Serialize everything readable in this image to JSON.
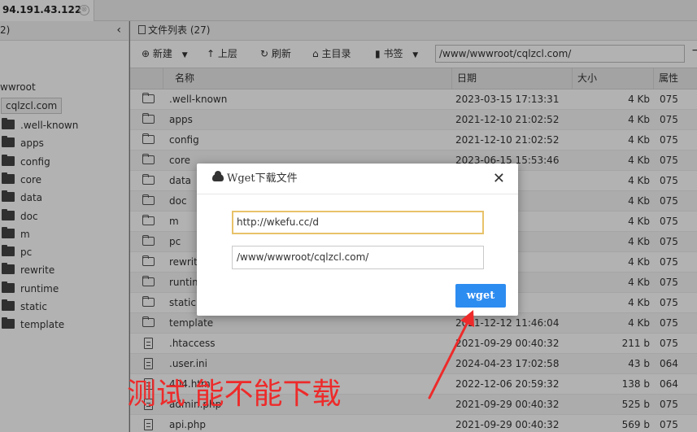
{
  "tab": {
    "title": "94.191.43.122",
    "close_symbol": "⊗"
  },
  "tree": {
    "header": "2)",
    "collapse_symbol": "‹",
    "root_label": "wwroot",
    "selected_label": "cqlzcl.com",
    "items": [
      ".well-known",
      "apps",
      "config",
      "core",
      "data",
      "doc",
      "m",
      "pc",
      "rewrite",
      "runtime",
      "static",
      "template"
    ]
  },
  "files": {
    "header_title": "文件列表 (27)",
    "toolbar": {
      "new_label": "新建",
      "up_label": "上层",
      "refresh_label": "刷新",
      "home_label": "主目录",
      "bookmark_label": "书签",
      "path_value": "/www/wwwroot/cqlzcl.com/"
    },
    "columns": {
      "name": "名称",
      "date": "日期",
      "size": "大小",
      "perm": "属性"
    },
    "rows": [
      {
        "icon": "folder-icon",
        "name": ".well-known",
        "date": "2023-03-15 17:13:31",
        "size": "4 Kb",
        "perm": "075"
      },
      {
        "icon": "folder-icon",
        "name": "apps",
        "date": "2021-12-10 21:02:52",
        "size": "4 Kb",
        "perm": "075"
      },
      {
        "icon": "folder-icon",
        "name": "config",
        "date": "2021-12-10 21:02:52",
        "size": "4 Kb",
        "perm": "075"
      },
      {
        "icon": "folder-icon",
        "name": "core",
        "date": "2023-06-15 15:53:46",
        "size": "4 Kb",
        "perm": "075"
      },
      {
        "icon": "folder-icon",
        "name": "data",
        "date": "7:08:44",
        "size": "4 Kb",
        "perm": "075"
      },
      {
        "icon": "folder-icon",
        "name": "doc",
        "date": "1:02:54",
        "size": "4 Kb",
        "perm": "075"
      },
      {
        "icon": "folder-icon",
        "name": "m",
        "date": "1:02:54",
        "size": "4 Kb",
        "perm": "075"
      },
      {
        "icon": "folder-icon",
        "name": "pc",
        "date": "1:02:54",
        "size": "4 Kb",
        "perm": "075"
      },
      {
        "icon": "folder-icon",
        "name": "rewrit",
        "date": "1:02:54",
        "size": "4 Kb",
        "perm": "075"
      },
      {
        "icon": "folder-icon",
        "name": "runtim",
        "date": "9:03:40",
        "size": "4 Kb",
        "perm": "075"
      },
      {
        "icon": "folder-icon",
        "name": "static",
        "date": "1:02:56",
        "size": "4 Kb",
        "perm": "075"
      },
      {
        "icon": "folder-icon",
        "name": "template",
        "date": "2021-12-12 11:46:04",
        "size": "4 Kb",
        "perm": "075"
      },
      {
        "icon": "file-icon",
        "name": ".htaccess",
        "date": "2021-09-29 00:40:32",
        "size": "211 b",
        "perm": "075"
      },
      {
        "icon": "file-icon",
        "name": ".user.ini",
        "date": "2024-04-23 17:02:58",
        "size": "43 b",
        "perm": "064"
      },
      {
        "icon": "file-icon",
        "name": "404.html",
        "date": "2022-12-06 20:59:32",
        "size": "138 b",
        "perm": "064"
      },
      {
        "icon": "file-icon",
        "name": "admin.php",
        "date": "2021-09-29 00:40:32",
        "size": "525 b",
        "perm": "075"
      },
      {
        "icon": "file-icon",
        "name": "api.php",
        "date": "2021-09-29 00:40:32",
        "size": "569 b",
        "perm": "075"
      }
    ]
  },
  "dialog": {
    "title": "Wget下载文件",
    "close_symbol": "✕",
    "url_value": "http://wkefu.cc/d",
    "path_value": "/www/wwwroot/cqlzcl.com/",
    "button_label": "wget"
  },
  "annotation": {
    "text": "测试 能不能下载",
    "color": "#ee2a2a"
  }
}
